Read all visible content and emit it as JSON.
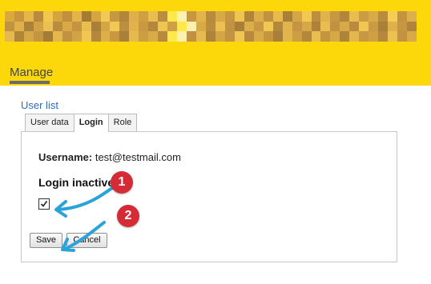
{
  "header": {
    "background_color": "#fcd80a",
    "banner_pixel_colors": [
      [
        "#d9a93a",
        "#c9963f",
        "#e7b64a",
        "#b98a3e",
        "#f0c84f",
        "#d7a33c",
        "#c28f3d",
        "#e4b44a",
        "#a57a33",
        "#d6a441",
        "#f2c955",
        "#c59843",
        "#b2863b",
        "#deaf4a",
        "#cf9f41",
        "#e9bd4f",
        "#bb8d3f",
        "#fde94a",
        "#fef1b0",
        "#c8963f",
        "#e2b44b",
        "#b78b3e",
        "#d8aa46",
        "#c69641",
        "#efc552",
        "#b0853a",
        "#dcae49",
        "#c29241",
        "#e7bb4e",
        "#a9803a",
        "#d4a646",
        "#f0c853",
        "#bd8e3f",
        "#e0b34c",
        "#c69842",
        "#b1863c",
        "#e8bc4f",
        "#cb9c43",
        "#d8ab48",
        "#b88b3e",
        "#f3cd55",
        "#c29440",
        "#deb04b"
      ],
      [
        "#c39440",
        "#e0b14a",
        "#ab8239",
        "#d1a244",
        "#ebc050",
        "#b98c3e",
        "#d8a946",
        "#c49541",
        "#e9be4f",
        "#a97f39",
        "#d5a645",
        "#f1c853",
        "#bc8e3f",
        "#e0b34b",
        "#c89942",
        "#b3873c",
        "#eec452",
        "#cf9f44",
        "#fde94a",
        "#fef1b0",
        "#d9ab47",
        "#b98c3e",
        "#ebbf50",
        "#c19241",
        "#a87f39",
        "#dcae49",
        "#c89843",
        "#efc753",
        "#b4883c",
        "#e1b34c",
        "#c59541",
        "#d7a847",
        "#ad833a",
        "#e9bd4f",
        "#c19341",
        "#d8aa47",
        "#b88b3e",
        "#f0c753",
        "#ca9b43",
        "#a98039",
        "#dfb14b",
        "#c69641",
        "#b0853b"
      ],
      [
        "#e6b94d",
        "#b1863b",
        "#d6a745",
        "#c59641",
        "#a57c37",
        "#e4b74c",
        "#c19241",
        "#d2a445",
        "#f0c753",
        "#b4883c",
        "#ddaf49",
        "#c89942",
        "#a98039",
        "#e5b94d",
        "#cc9d43",
        "#d9ab47",
        "#b78a3e",
        "#fde94a",
        "#fef1b0",
        "#c09141",
        "#e6ba4e",
        "#ae843a",
        "#d4a545",
        "#c29341",
        "#efc652",
        "#b8893e",
        "#daac48",
        "#c59641",
        "#a87f39",
        "#e2b54c",
        "#cd9e43",
        "#b3873c",
        "#e9be50",
        "#c49541",
        "#d6a846",
        "#ae843a",
        "#e4b74d",
        "#c89942",
        "#d0a144",
        "#b5893d",
        "#ecc151",
        "#c39341",
        "#d7a947"
      ]
    ]
  },
  "nav": {
    "manage_label": "Manage"
  },
  "breadcrumb": {
    "user_list_label": "User list"
  },
  "tabs": [
    {
      "label": "User data",
      "active": false
    },
    {
      "label": "Login",
      "active": true
    },
    {
      "label": "Role",
      "active": false
    }
  ],
  "form": {
    "username_label": "Username:",
    "username_value": "test@testmail.com",
    "login_inactive_label": "Login inactive",
    "login_inactive_checked": true,
    "save_label": "Save",
    "cancel_label": "Cancel"
  },
  "annotations": {
    "badge_color": "#d52b37",
    "arrow_color": "#29a3d8",
    "badges": [
      "1",
      "2"
    ]
  }
}
